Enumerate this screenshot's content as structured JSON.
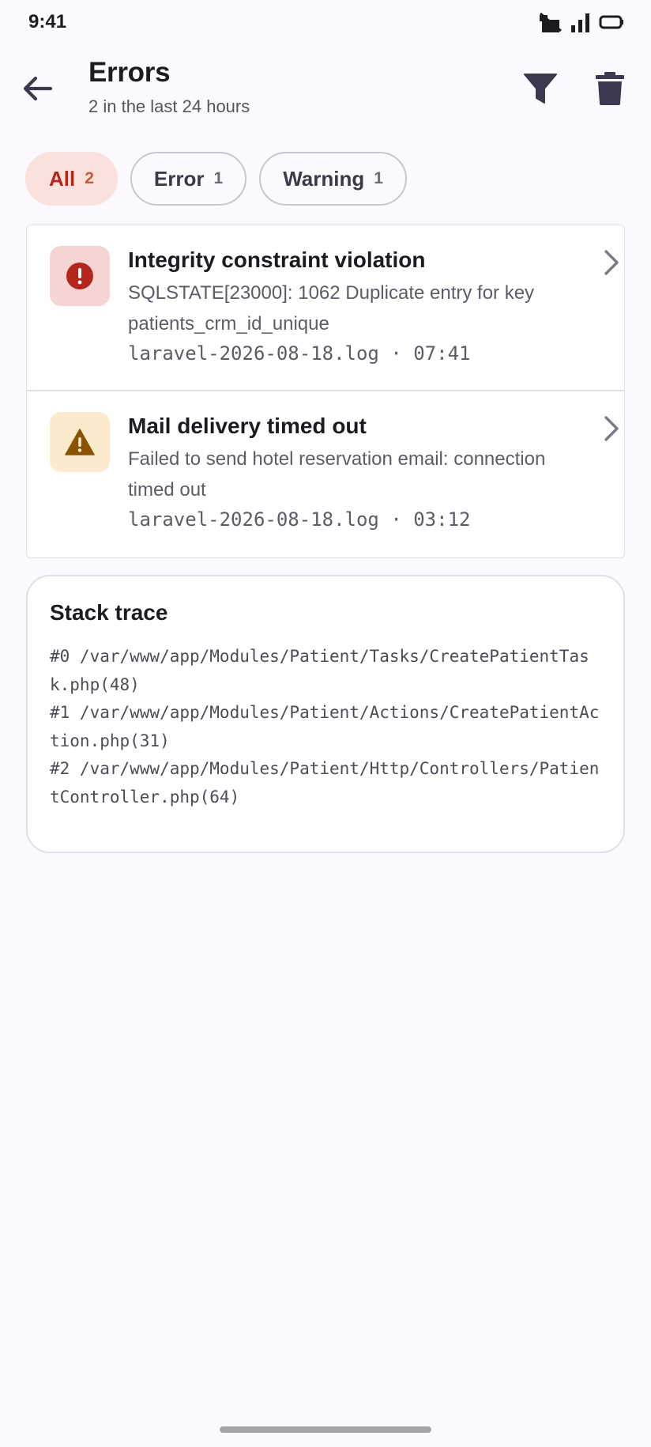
{
  "status_bar": {
    "time": "9:41"
  },
  "header": {
    "title": "Errors",
    "subtitle": "2 in the last 24 hours",
    "back_icon": "arrow-left-icon",
    "filter_icon": "filter-icon",
    "delete_icon": "trash-icon"
  },
  "chips": [
    {
      "label": "All",
      "count": "2",
      "selected": true
    },
    {
      "label": "Error",
      "count": "1",
      "selected": false
    },
    {
      "label": "Warning",
      "count": "1",
      "selected": false
    }
  ],
  "entries": [
    {
      "level": "error",
      "icon": "error-icon",
      "title": "Integrity constraint violation",
      "message": "SQLSTATE[23000]: 1062 Duplicate entry for key patients_crm_id_unique",
      "meta": "laravel-2026-08-18.log · 07:41"
    },
    {
      "level": "warning",
      "icon": "warning-icon",
      "title": "Mail delivery timed out",
      "message": "Failed to send hotel reservation email: connection timed out",
      "meta": "laravel-2026-08-18.log · 03:12"
    }
  ],
  "stack_trace": {
    "title": "Stack trace",
    "lines": [
      "#0 /var/www/app/Modules/Patient/Tasks/CreatePatientTask.php(48)",
      "#1 /var/www/app/Modules/Patient/Actions/CreatePatientAction.php(31)",
      "#2 /var/www/app/Modules/Patient/Http/Controllers/PatientController.php(64)"
    ]
  },
  "colors": {
    "background": "#fbf8fe",
    "accent": "#b3261e",
    "error_icon": "#b3261e",
    "warning_icon": "#8a5300"
  }
}
